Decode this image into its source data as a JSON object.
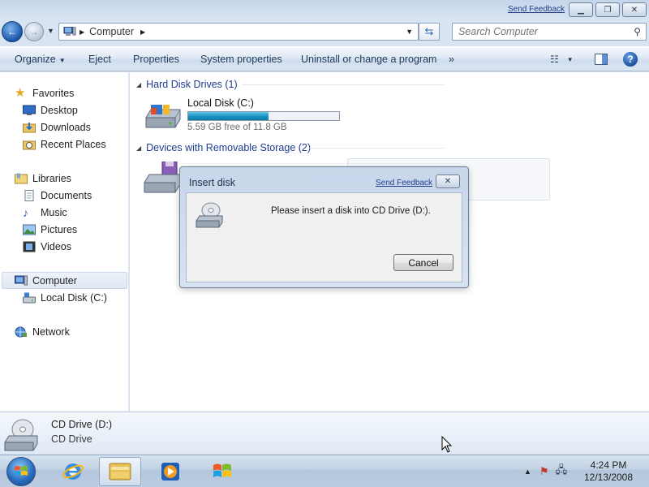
{
  "titlebar": {
    "send_feedback": "Send Feedback",
    "buttons": [
      "minimize-button",
      "maximize-button",
      "close-button"
    ]
  },
  "address": {
    "location": "Computer",
    "search_placeholder": "Search Computer"
  },
  "commands": {
    "organize": "Organize",
    "eject": "Eject",
    "properties": "Properties",
    "system_properties": "System properties",
    "uninstall": "Uninstall or change a program",
    "more": "»"
  },
  "nav": {
    "favorites": "Favorites",
    "desktop": "Desktop",
    "downloads": "Downloads",
    "recent_places": "Recent Places",
    "libraries": "Libraries",
    "documents": "Documents",
    "music": "Music",
    "pictures": "Pictures",
    "videos": "Videos",
    "computer": "Computer",
    "local_disk": "Local Disk (C:)",
    "network": "Network"
  },
  "content": {
    "hard_disk_group": "Hard Disk Drives (1)",
    "removable_group": "Devices with Removable Storage (2)",
    "drive": {
      "name": "Local Disk (C:)",
      "free_text": "5.59 GB free of 11.8 GB",
      "used_fraction": 0.53
    }
  },
  "dialog": {
    "title": "Insert disk",
    "send_feedback": "Send Feedback",
    "message": "Please insert a disk into CD Drive (D:).",
    "cancel": "Cancel"
  },
  "details": {
    "name": "CD Drive (D:)",
    "type": "CD Drive"
  },
  "taskbar": {
    "time": "4:24 PM",
    "date": "12/13/2008"
  },
  "colors": {
    "accent": "#1e3d8f",
    "progress": "#1a93c1"
  }
}
